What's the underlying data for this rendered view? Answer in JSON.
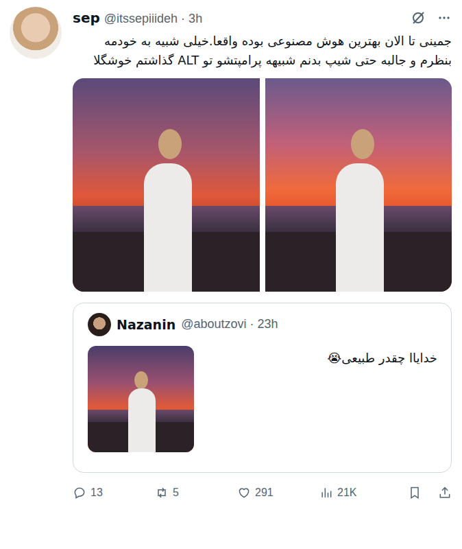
{
  "post": {
    "author": "sep",
    "meta": "@itssepiiideh · 3h",
    "text": "جمینی تا الان بهترین هوش مصنوعی بوده واقعا.خیلی شبیه به خودمه بنظرم و جالبه حتی شیپ بدنم شبیهه پرامپتشو تو ALT گذاشتم خوشگلا"
  },
  "quote": {
    "author": "Nazanin",
    "meta": "@aboutzovi · 23h",
    "text": "خدایاا چقدر طبیعی😭"
  },
  "actions": [
    {
      "kind": "reply",
      "count": "13"
    },
    {
      "kind": "repost",
      "count": "5"
    },
    {
      "kind": "like",
      "count": "291"
    },
    {
      "kind": "views",
      "count": "21K"
    },
    {
      "kind": "bookmark",
      "count": ""
    },
    {
      "kind": "share",
      "count": ""
    }
  ]
}
